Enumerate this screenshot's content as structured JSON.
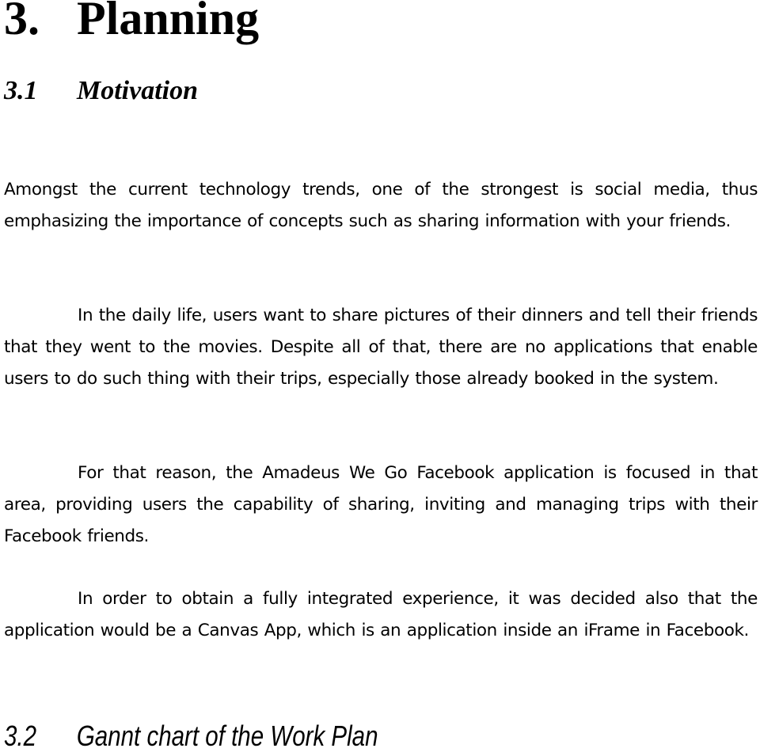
{
  "document": {
    "chapter": {
      "number": "3.",
      "title": "Planning"
    },
    "section_motivation": {
      "number": "3.1",
      "title": "Motivation"
    },
    "paragraphs": [
      "Amongst the current technology trends, one of the strongest is social media, thus emphasizing the importance of concepts such as sharing information with your friends.",
      "In the daily life, users want to share pictures of their dinners and tell their friends that they went to the movies. Despite all of that, there are no applications that enable users to do such thing with their trips, especially those already booked in the system.",
      "For that reason, the Amadeus We Go Facebook application is focused in that area, providing users the capability of sharing, inviting and managing trips with their Facebook friends.",
      "In order to obtain a fully integrated experience, it was decided also that the application would be a Canvas App, which is an application inside an iFrame in Facebook."
    ],
    "section_gannt": {
      "number": "3.2",
      "title": "Gannt chart of the Work Plan"
    }
  }
}
